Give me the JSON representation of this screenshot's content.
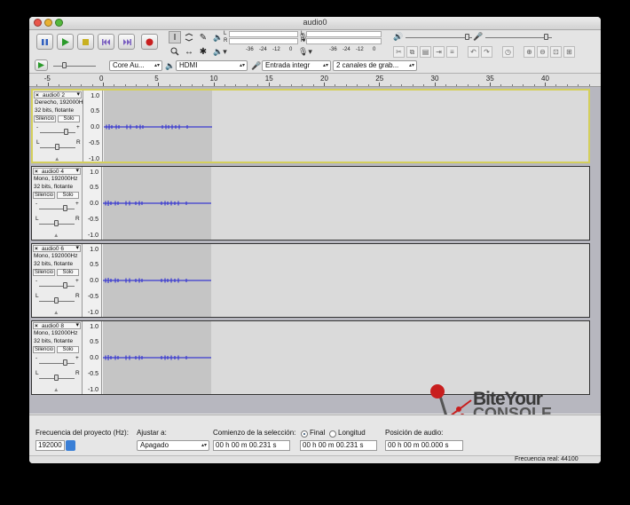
{
  "window": {
    "title": "audio0"
  },
  "ruler": {
    "ticks": [
      "-5",
      "0",
      "5",
      "10",
      "15",
      "20",
      "25",
      "30",
      "35",
      "40"
    ]
  },
  "meters": {
    "scale_a": [
      "-36",
      "-24",
      "-12",
      "0"
    ],
    "scale_b": [
      "-36",
      "-24",
      "-12",
      "0"
    ],
    "channel_l": "L",
    "channel_r": "R"
  },
  "device_toolbar": {
    "host": "Core Au...",
    "output": "HDMI",
    "input": "Entrada integr",
    "channels": "2 canales de grab..."
  },
  "tracks": [
    {
      "name": "audio0 2",
      "info1": "Derecho, 192000Hz",
      "info2": "32 bits, flotante",
      "mute": "Silencio",
      "solo": "Solo",
      "selected": true
    },
    {
      "name": "audio0 4",
      "info1": "Mono, 192000Hz",
      "info2": "32 bits, flotante",
      "mute": "Silencio",
      "solo": "Solo",
      "selected": false
    },
    {
      "name": "audio0 6",
      "info1": "Mono, 192000Hz",
      "info2": "32 bits, flotante",
      "mute": "Silencio",
      "solo": "Solo",
      "selected": false
    },
    {
      "name": "audio0 8",
      "info1": "Mono, 192000Hz",
      "info2": "32 bits, flotante",
      "mute": "Silencio",
      "solo": "Solo",
      "selected": false
    }
  ],
  "track_labels": {
    "gain_minus": "-",
    "gain_plus": "+",
    "pan_l": "L",
    "pan_r": "R"
  },
  "amplitude_scale": [
    "1.0",
    "0.5",
    "0.0",
    "-0.5",
    "-1.0"
  ],
  "watermark": {
    "line1": "BiteYour",
    "line2": "CONSOLE"
  },
  "selection_bar": {
    "rate_label": "Frecuencia del proyecto (Hz):",
    "rate_value": "192000",
    "snap_label": "Ajustar a:",
    "snap_value": "Apagado",
    "sel_start_label": "Comienzo de la selección:",
    "end_label": "Final",
    "length_label": "Longitud",
    "sel_start_value": "00 h 00 m 00.231 s",
    "sel_end_value": "00 h 00 m 00.231 s",
    "audio_pos_label": "Posición de audio:",
    "audio_pos_value": "00 h 00 m 00.000 s"
  },
  "status": {
    "actual_rate": "Frecuencia real: 44100"
  },
  "colors": {
    "waveform": "#3a3ad0",
    "selected_track_border": "#d4cf5c",
    "record": "#c81e1e",
    "play": "#2a9a2a"
  }
}
